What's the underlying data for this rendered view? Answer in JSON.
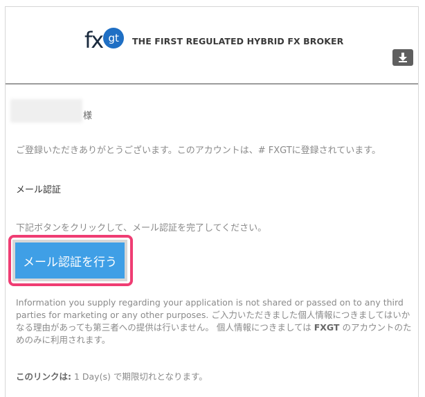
{
  "header": {
    "logo_text": "fx",
    "logo_badge": "gt",
    "tagline": "THE FIRST REGULATED HYBRID FX BROKER",
    "download_icon": "download-icon"
  },
  "greeting": {
    "honorific": "様"
  },
  "body": {
    "registered_text": "ご登録いただきありがとうございます。このアカウントは、# FXGTに登録されています。",
    "mail_verify_heading": "メール認証",
    "instruction_text": "下記ボタンをクリックして、メール認証を完了してください。",
    "cta_label": "メール認証を行う"
  },
  "info": {
    "text_part1": "Information you supply regarding your application is not shared or passed on to any third parties for marketing or any other purposes. ご入力いただきました個人情報につきましてはいかなる理由があっても第三者への提供は行いません。 個人情報につきましては",
    "brand": "FXGT",
    "text_part2": "のアカウントのためのみに利用されます。"
  },
  "link_expiry": {
    "label": "このリンクは:",
    "value": " 1 Day(s) で期限切れとなります。"
  },
  "colors": {
    "cta_bg": "#3f9fe6",
    "highlight": "#ef3d73",
    "logo_badge": "#1f6fc4"
  }
}
